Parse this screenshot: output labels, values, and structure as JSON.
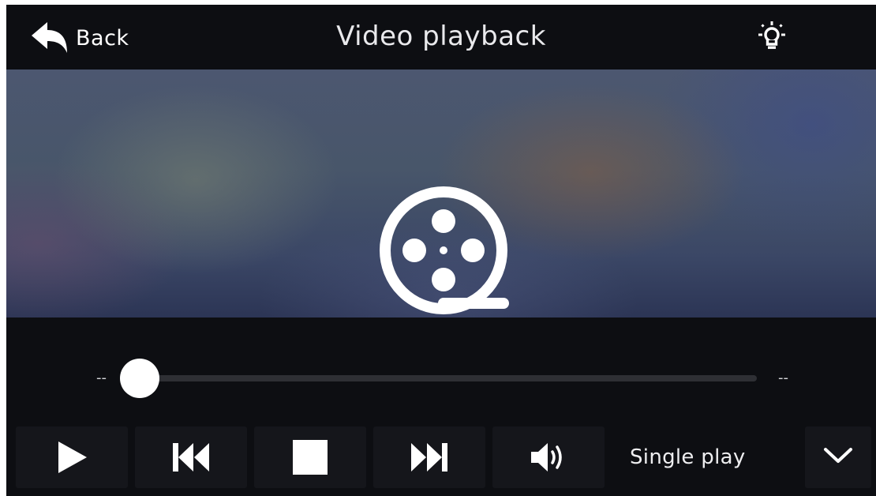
{
  "header": {
    "back_label": "Back",
    "title": "Video playback",
    "back_icon": "back-arrow-icon",
    "brightness_icon": "lightbulb-icon"
  },
  "video": {
    "placeholder_icon": "film-reel-icon"
  },
  "progress": {
    "current_time": "--",
    "total_time": "--",
    "position_fraction": 0.0
  },
  "controls": {
    "buttons": [
      {
        "name": "play",
        "icon": "play-icon"
      },
      {
        "name": "previous",
        "icon": "skip-previous-icon"
      },
      {
        "name": "stop",
        "icon": "stop-icon"
      },
      {
        "name": "next",
        "icon": "skip-next-icon"
      },
      {
        "name": "volume",
        "icon": "volume-icon"
      }
    ],
    "play_mode": "Single play",
    "dropdown_icon": "chevron-down-icon"
  },
  "colors": {
    "background": "#0d0e12",
    "button_bg": "#15161b",
    "foreground": "#ffffff"
  }
}
